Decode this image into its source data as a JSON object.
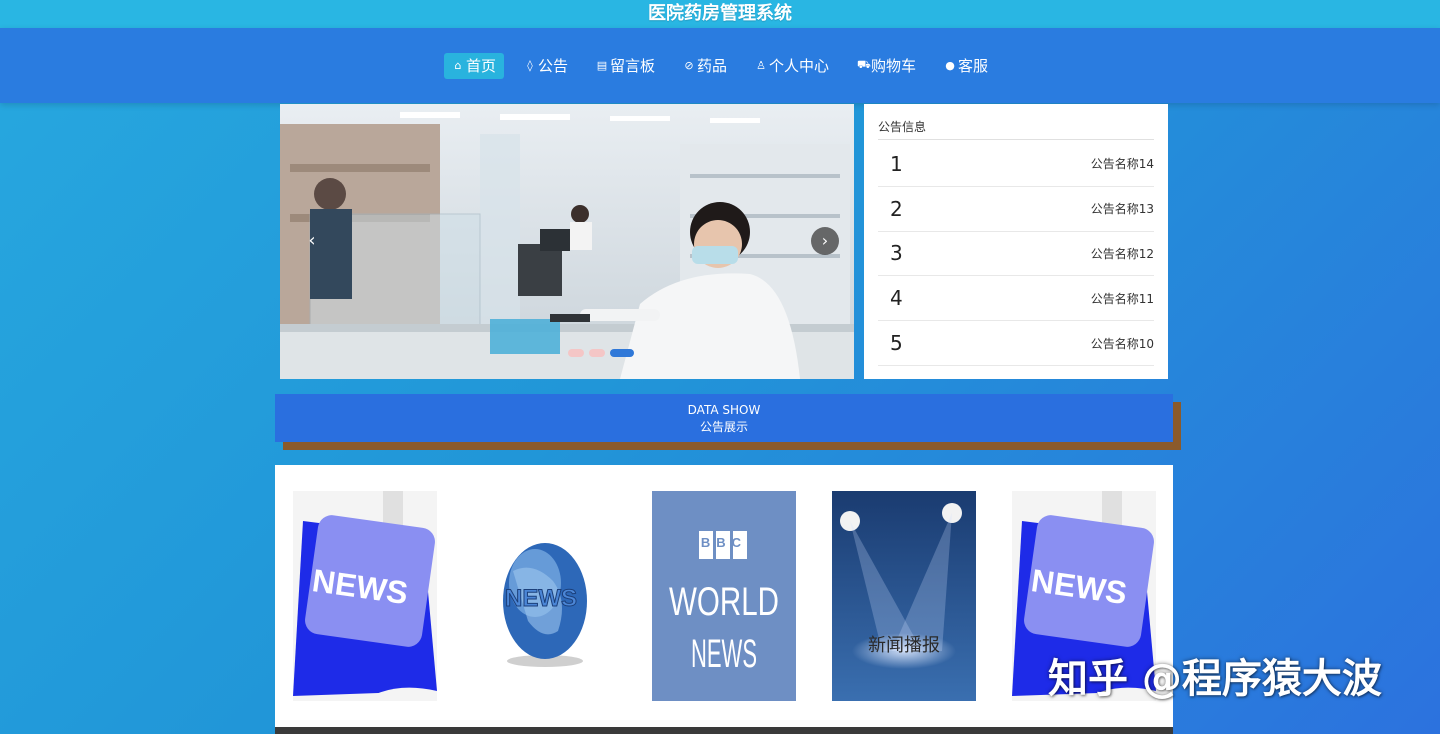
{
  "app": {
    "title": "医院药房管理系统"
  },
  "nav": {
    "items": [
      {
        "icon": "home-icon",
        "glyph": "⌂",
        "label": "首页",
        "active": true
      },
      {
        "icon": "tag-icon",
        "glyph": "◊",
        "label": "公告",
        "active": false
      },
      {
        "icon": "board-icon",
        "glyph": "▤",
        "label": "留言板",
        "active": false
      },
      {
        "icon": "pill-icon",
        "glyph": "⊘",
        "label": "药品",
        "active": false
      },
      {
        "icon": "user-icon",
        "glyph": "♙",
        "label": "个人中心",
        "active": false
      },
      {
        "icon": "cart-icon",
        "glyph": "⛟",
        "label": "购物车",
        "active": false
      },
      {
        "icon": "support-icon",
        "glyph": "●",
        "label": "客服",
        "active": false
      }
    ]
  },
  "carousel": {
    "prev_glyph": "‹",
    "next_glyph": "›",
    "slide_count": 3,
    "active_slide": 3
  },
  "notices": {
    "title": "公告信息",
    "items": [
      {
        "num": "1",
        "name": "公告名称14"
      },
      {
        "num": "2",
        "name": "公告名称13"
      },
      {
        "num": "3",
        "name": "公告名称12"
      },
      {
        "num": "4",
        "name": "公告名称11"
      },
      {
        "num": "5",
        "name": "公告名称10"
      }
    ]
  },
  "section": {
    "title_en": "DATA SHOW",
    "title_cn": "公告展示"
  },
  "gallery": {
    "items": [
      {
        "text": "NEWS"
      },
      {
        "text": "NEWS"
      },
      {
        "line1": "BBC",
        "line2": "WORLD",
        "line3": "NEWS"
      },
      {
        "text": "新闻播报"
      },
      {
        "text": "NEWS"
      }
    ]
  },
  "watermark": {
    "text": "知乎 @程序猿大波"
  },
  "colors": {
    "nav_bg": "#2a7ce0",
    "nav_active": "#29b3de",
    "titlebar": "#29b6e3",
    "section_header": "#2a6fdf",
    "section_shadow": "#8b5a2b"
  }
}
